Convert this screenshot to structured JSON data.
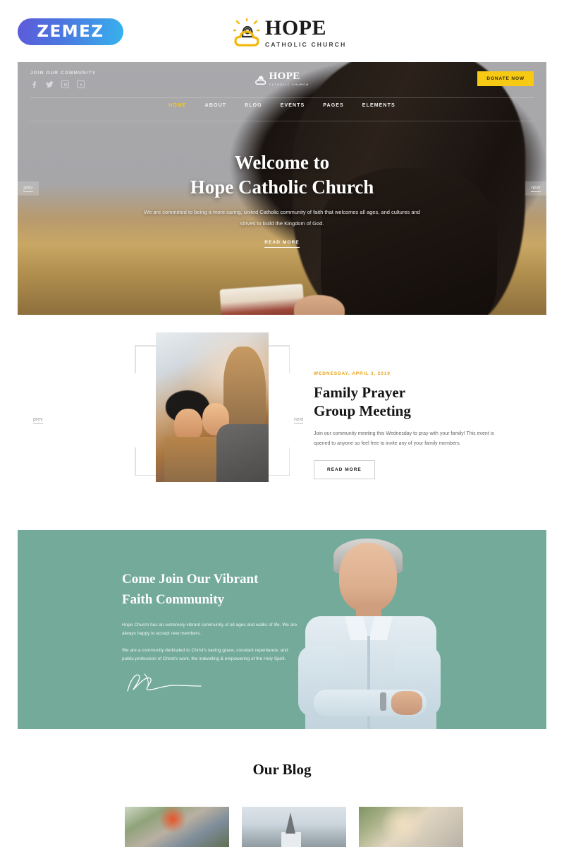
{
  "topbar": {
    "zemez_logo_text": "ZEMEZ",
    "brand_title": "HOPE",
    "brand_subtitle": "CATHOLIC CHURCH",
    "brand_mark_icon": "church-cloud-sun-icon"
  },
  "hero": {
    "join_label": "JOIN OUR COMMUNITY",
    "social": [
      {
        "name": "facebook-icon",
        "glyph": "f"
      },
      {
        "name": "twitter-icon",
        "glyph": "ᵗ"
      },
      {
        "name": "instagram-icon",
        "glyph": "▣"
      },
      {
        "name": "youtube-icon",
        "glyph": "▶"
      }
    ],
    "logo_title": "HOPE",
    "logo_subtitle": "CATHOLIC CHURCH",
    "donate_label": "DONATE NOW",
    "nav": [
      {
        "label": "HOME",
        "active": true
      },
      {
        "label": "ABOUT",
        "active": false
      },
      {
        "label": "BLOG",
        "active": false
      },
      {
        "label": "EVENTS",
        "active": false
      },
      {
        "label": "PAGES",
        "active": false
      },
      {
        "label": "ELEMENTS",
        "active": false
      }
    ],
    "heading_line1": "Welcome to",
    "heading_line2": "Hope Catholic Church",
    "paragraph": "We are committed to being a more caring, united Catholic community of faith that welcomes all ages, and cultures and strives to build the Kingdom of God.",
    "read_more_label": "READ MORE",
    "prev_label": "prev",
    "next_label": "next"
  },
  "events": {
    "prev_label": "prev",
    "next_label": "next",
    "date": "WEDNESDAY, APRIL 3, 2019",
    "title_line1": "Family Prayer",
    "title_line2": "Group Meeting",
    "description": "Join our community meeting this Wednesday to pray with your family! This event is opened to anyone so feel free to invite any of your family members.",
    "read_more_label": "READ MORE",
    "image_alt": "three-women-laughing-photo"
  },
  "community": {
    "heading_line1": "Come Join Our Vibrant",
    "heading_line2": "Faith Community",
    "paragraph1": "Hope Church has an extremely vibrant community of all ages and walks of life. We are always happy to accept new members.",
    "paragraph2": "We are a community dedicated to Christ's saving grace, constant repentance, and public profession of Christ's work, the indwelling & empowering of the Holy Spirit.",
    "signature_alt": "handwritten-signature",
    "portrait_alt": "smiling-older-man-portrait",
    "background_color": "#73aa99"
  },
  "blog": {
    "heading": "Our Blog",
    "cards": [
      {
        "alt": "man-in-orange-cap-working-photo"
      },
      {
        "alt": "white-church-steeple-in-mist-photo"
      },
      {
        "alt": "blonde-woman-smiling-outdoors-photo"
      }
    ]
  },
  "colors": {
    "accent_yellow": "#f6c915",
    "accent_green": "#73aa99",
    "date_gold": "#e8a317",
    "text_dark": "#141414"
  }
}
